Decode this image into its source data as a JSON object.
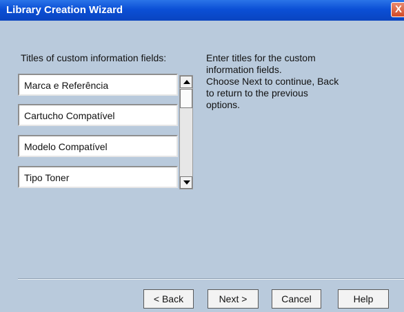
{
  "window": {
    "title": "Library Creation Wizard",
    "close_glyph": "X"
  },
  "left": {
    "label": "Titles of custom information fields:",
    "fields": [
      "Marca e Referência",
      "Cartucho Compatível",
      "Modelo Compatível",
      "Tipo Toner"
    ]
  },
  "instructions": {
    "lines": [
      "Enter titles for the custom",
      "information fields.",
      "Choose Next to continue, Back",
      "to return to the previous",
      "options."
    ]
  },
  "buttons": {
    "back": "< Back",
    "next": "Next >",
    "cancel": "Cancel",
    "help": "Help"
  },
  "colors": {
    "titlebar": "#0b4fd6",
    "background": "#b9cadc"
  }
}
